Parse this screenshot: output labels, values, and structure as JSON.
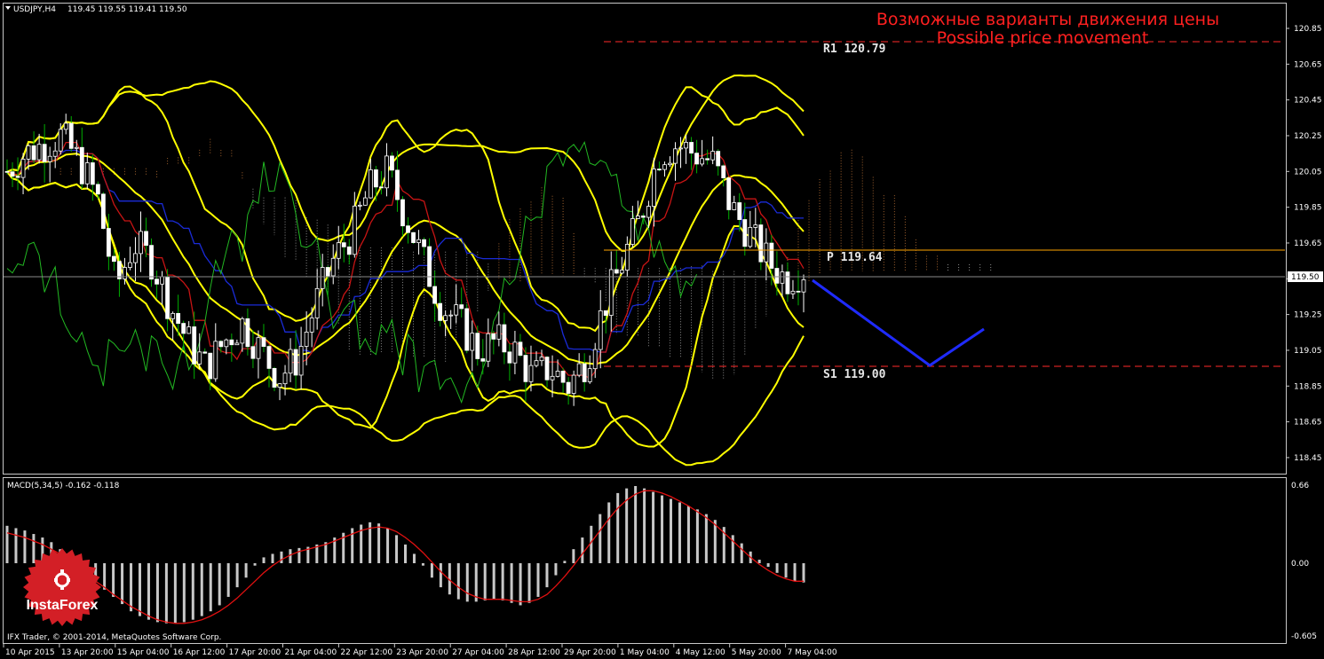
{
  "header": {
    "symbol_label": "USDJPY,H4",
    "ohlc": "119.45 119.55 119.41 119.50"
  },
  "annotations": {
    "title_ru": "Возможные варианты движения цены",
    "title_en": "Possible price movement",
    "r1_label": "R1 120.79",
    "pivot_label": "P 119.64",
    "s1_label": "S1 119.00",
    "current_price": "119.50"
  },
  "macd_panel": {
    "label": "MACD(5,34,5) -0.162 -0.118",
    "axis": [
      "0.66",
      "0.00",
      "-0.605"
    ]
  },
  "footer": {
    "copyright": "IFX Trader, © 2001-2014, MetaQuotes Software Corp."
  },
  "logo": {
    "text": "InstaForex"
  },
  "colors": {
    "background": "#000000",
    "bull": "#ffffff",
    "bear": "#008000",
    "bollinger": "#ffff00",
    "forecast": "#0000ff",
    "levels": "#ff0000",
    "pivot": "#ffa500",
    "macd_signal": "#ff0000",
    "logo": "#d31f26"
  },
  "chart_data": [
    {
      "type": "candlestick",
      "title": "USDJPY,H4",
      "ylim": [
        118.4,
        120.85
      ],
      "y_ticks": [
        120.85,
        120.65,
        120.45,
        120.25,
        120.05,
        119.85,
        119.65,
        119.45,
        119.25,
        119.05,
        118.85,
        118.65,
        118.45
      ],
      "x_ticks": [
        "10 Apr 2015",
        "13 Apr 20:00",
        "15 Apr 04:00",
        "16 Apr 12:00",
        "17 Apr 20:00",
        "21 Apr 04:00",
        "22 Apr 12:00",
        "23 Apr 20:00",
        "27 Apr 04:00",
        "28 Apr 12:00",
        "29 Apr 20:00",
        "1 May 04:00",
        "4 May 12:00",
        "5 May 20:00",
        "7 May 04:00"
      ],
      "levels": [
        {
          "name": "R1",
          "value": 120.79
        },
        {
          "name": "P",
          "value": 119.64
        },
        {
          "name": "S1",
          "value": 119.0
        }
      ],
      "last_price": 119.5,
      "close_series": [
        120.05,
        120.15,
        120.2,
        120.25,
        120.1,
        119.9,
        119.4,
        119.65,
        119.55,
        119.3,
        119.1,
        118.95,
        119.1,
        119.2,
        119.05,
        118.9,
        119.0,
        119.3,
        119.55,
        119.7,
        119.95,
        120.05,
        119.8,
        119.55,
        119.3,
        119.2,
        119.05,
        119.1,
        119.05,
        118.9,
        118.95,
        118.85,
        119.0,
        119.3,
        119.55,
        119.8,
        120.15,
        120.2,
        120.15,
        120.1,
        119.85,
        119.7,
        119.55,
        119.45,
        119.5
      ],
      "forecast_path": [
        {
          "x": "7 May 04:00",
          "y": 119.5
        },
        {
          "x": "8 May",
          "y": 119.0
        },
        {
          "x": "8 May",
          "y": 119.2
        }
      ]
    },
    {
      "type": "bar",
      "title": "MACD(5,34,5)",
      "ylim": [
        -0.605,
        0.66
      ],
      "macd_value": -0.162,
      "signal_value": -0.118,
      "histogram": [
        0.32,
        0.3,
        0.28,
        0.25,
        0.22,
        0.18,
        0.12,
        0.05,
        -0.03,
        -0.1,
        -0.16,
        -0.22,
        -0.28,
        -0.34,
        -0.4,
        -0.44,
        -0.47,
        -0.49,
        -0.5,
        -0.5,
        -0.49,
        -0.47,
        -0.44,
        -0.4,
        -0.35,
        -0.28,
        -0.2,
        -0.12,
        -0.02,
        0.05,
        0.08,
        0.1,
        0.12,
        0.13,
        0.14,
        0.16,
        0.18,
        0.22,
        0.26,
        0.3,
        0.33,
        0.35,
        0.34,
        0.3,
        0.24,
        0.16,
        0.08,
        -0.02,
        -0.12,
        -0.2,
        -0.26,
        -0.3,
        -0.32,
        -0.32,
        -0.31,
        -0.3,
        -0.31,
        -0.33,
        -0.35,
        -0.33,
        -0.28,
        -0.2,
        -0.1,
        0.02,
        0.12,
        0.22,
        0.32,
        0.42,
        0.52,
        0.6,
        0.64,
        0.66,
        0.64,
        0.61,
        0.58,
        0.55,
        0.52,
        0.49,
        0.46,
        0.42,
        0.37,
        0.31,
        0.24,
        0.17,
        0.1,
        0.03,
        -0.03,
        -0.08,
        -0.12,
        -0.15,
        -0.16
      ],
      "signal": [
        0.26,
        0.24,
        0.22,
        0.19,
        0.16,
        0.12,
        0.08,
        0.03,
        -0.03,
        -0.09,
        -0.15,
        -0.2,
        -0.26,
        -0.31,
        -0.36,
        -0.4,
        -0.44,
        -0.47,
        -0.49,
        -0.5,
        -0.5,
        -0.49,
        -0.47,
        -0.44,
        -0.4,
        -0.35,
        -0.29,
        -0.22,
        -0.15,
        -0.08,
        -0.02,
        0.03,
        0.07,
        0.1,
        0.12,
        0.14,
        0.16,
        0.19,
        0.22,
        0.25,
        0.28,
        0.3,
        0.31,
        0.3,
        0.27,
        0.22,
        0.16,
        0.09,
        0.01,
        -0.07,
        -0.14,
        -0.2,
        -0.25,
        -0.28,
        -0.3,
        -0.3,
        -0.3,
        -0.31,
        -0.32,
        -0.32,
        -0.3,
        -0.26,
        -0.19,
        -0.11,
        -0.02,
        0.08,
        0.18,
        0.28,
        0.38,
        0.47,
        0.54,
        0.59,
        0.62,
        0.62,
        0.6,
        0.57,
        0.53,
        0.49,
        0.44,
        0.39,
        0.33,
        0.26,
        0.19,
        0.12,
        0.05,
        -0.01,
        -0.06,
        -0.1,
        -0.13,
        -0.15,
        -0.15
      ]
    }
  ]
}
